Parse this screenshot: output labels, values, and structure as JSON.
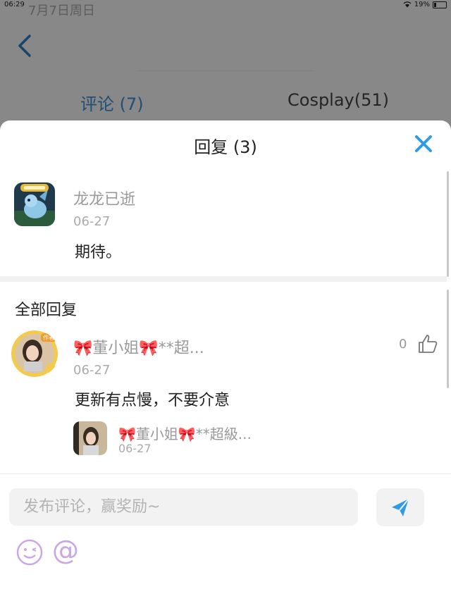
{
  "status_bar": {
    "time": "06:29",
    "date": "7月7日周日",
    "battery": "19%",
    "battery_level": 0.19
  },
  "background": {
    "tabs": [
      {
        "label": "评论 (7)"
      },
      {
        "label": "Cosplay(51)"
      }
    ]
  },
  "sheet": {
    "title": "回复 (3)",
    "original_comment": {
      "username": "龙龙已逝",
      "date": "06-27",
      "content": "期待。"
    },
    "section_title": "全部回复",
    "reply": {
      "username": "🎀董小姐🎀**超...",
      "date": "06-27",
      "content": "更新有点慢，不要介意",
      "likes": "0"
    },
    "nested_reply": {
      "username": "🎀董小姐🎀**超級...",
      "date": "06-27"
    }
  },
  "composer": {
    "placeholder": "发布评论，赢奖励~"
  },
  "colors": {
    "accent": "#2d9be8",
    "tab_active": "#3b8fd6",
    "emoji": "#c9a6e8"
  },
  "icons": [
    "back-chevron-icon",
    "close-icon",
    "thumbs-up-icon",
    "send-icon",
    "emoji-icon",
    "at-icon"
  ]
}
